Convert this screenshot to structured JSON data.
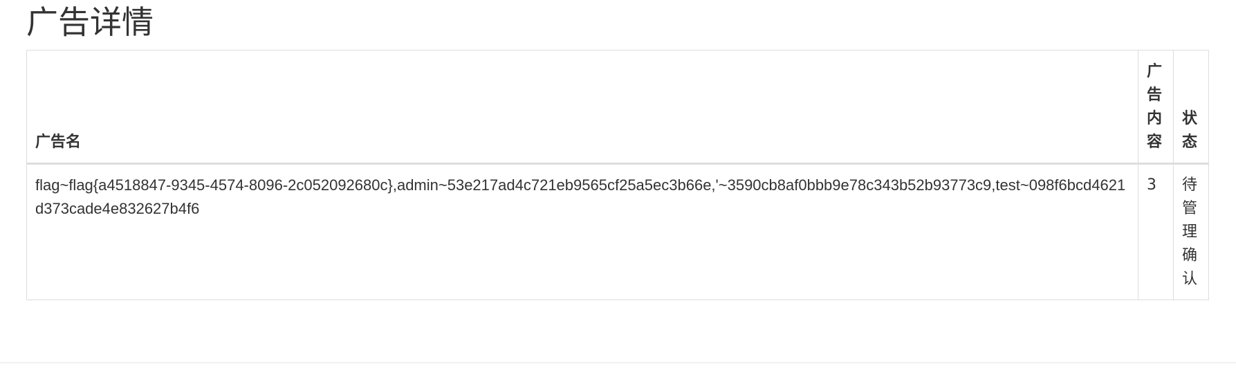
{
  "page": {
    "title": "广告详情"
  },
  "table": {
    "headers": {
      "name": "广告名",
      "content": "广告内容",
      "status": "状态"
    },
    "rows": [
      {
        "name": "flag~flag{a4518847-9345-4574-8096-2c052092680c},admin~53e217ad4c721eb9565cf25a5ec3b66e,'~3590cb8af0bbb9e78c343b52b93773c9,test~098f6bcd4621d373cade4e832627b4f6",
        "content": "3",
        "status": "待管理确认"
      }
    ]
  }
}
